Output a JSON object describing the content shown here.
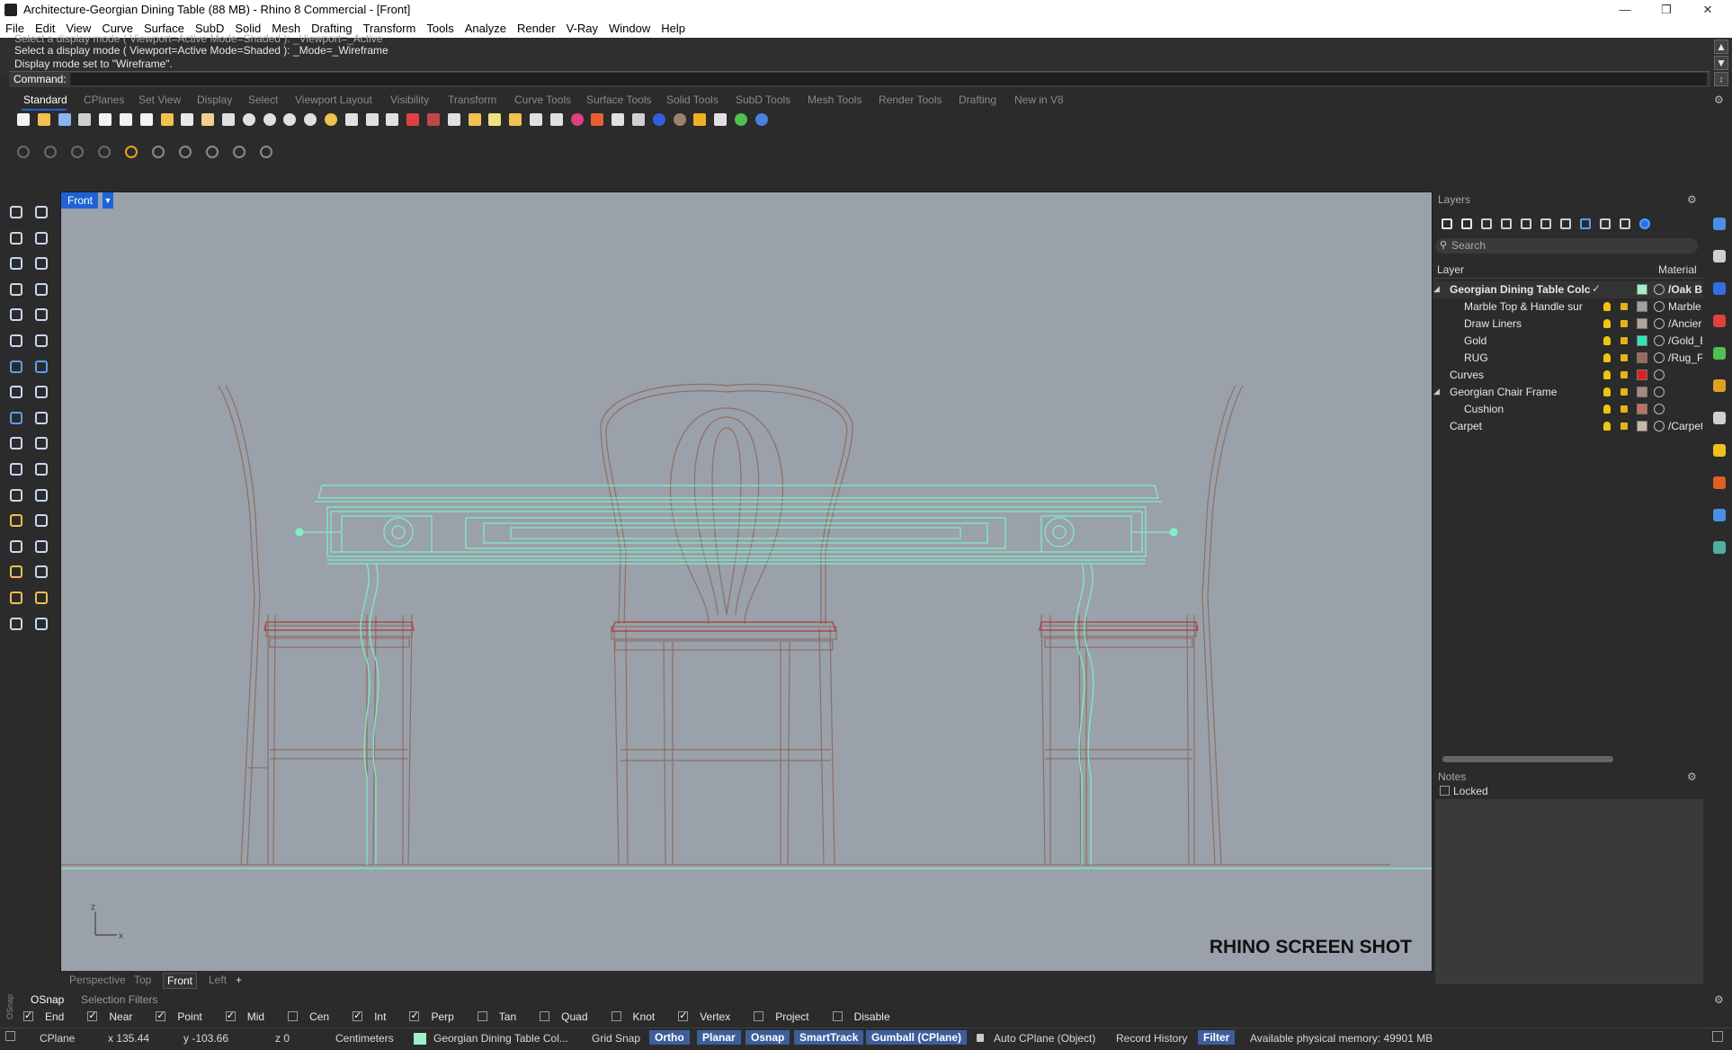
{
  "window": {
    "title": "Architecture-Georgian Dining Table (88 MB) - Rhino 8 Commercial - [Front]"
  },
  "menu": [
    "File",
    "Edit",
    "View",
    "Curve",
    "Surface",
    "SubD",
    "Solid",
    "Mesh",
    "Drafting",
    "Transform",
    "Tools",
    "Analyze",
    "Render",
    "V-Ray",
    "Window",
    "Help"
  ],
  "command_history": {
    "line0": "Select a display mode ( Viewport=Active  Mode=Shaded ): _Viewport=_Active",
    "line1": "Select a display mode ( Viewport=Active  Mode=Shaded ): _Mode=_Wireframe",
    "line2": "Display mode set to \"Wireframe\"."
  },
  "command_prompt": {
    "label": "Command:",
    "value": ""
  },
  "toolbar_tabs": [
    "Standard",
    "CPlanes",
    "Set View",
    "Display",
    "Select",
    "Viewport Layout",
    "Visibility",
    "Transform",
    "Curve Tools",
    "Surface Tools",
    "Solid Tools",
    "SubD Tools",
    "Mesh Tools",
    "Render Tools",
    "Drafting",
    "New in V8"
  ],
  "viewport": {
    "label": "Front",
    "watermark": "RHINO SCREEN SHOT",
    "axis_z": "z",
    "axis_x": "x"
  },
  "viewport_tabs": [
    "Perspective",
    "Top",
    "Front",
    "Left"
  ],
  "viewport_tab_add": "+",
  "layers_panel": {
    "title": "Layers",
    "search_placeholder": "Search",
    "col_layer": "Layer",
    "col_material": "Material",
    "rows": [
      {
        "name": "Georgian Dining Table Colc",
        "material": "/Oak B",
        "color": "#9ef0c8"
      },
      {
        "name": "Marble Top & Handle sur",
        "material": "Marble",
        "color": "#a0a0a0"
      },
      {
        "name": "Draw Liners",
        "material": "/Ancier",
        "color": "#b0a59a"
      },
      {
        "name": "Gold",
        "material": "/Gold_E",
        "color": "#2ee8b8"
      },
      {
        "name": "RUG",
        "material": "/Rug_P",
        "color": "#9c6b60"
      },
      {
        "name": "Curves",
        "material": "",
        "color": "#e02020"
      },
      {
        "name": "Georgian Chair Frame",
        "material": "",
        "color": "#a58a80"
      },
      {
        "name": "Cushion",
        "material": "",
        "color": "#c07060"
      },
      {
        "name": "Carpet",
        "material": "/Carpet",
        "color": "#c8b8a8"
      }
    ]
  },
  "notes_panel": {
    "title": "Notes",
    "locked_label": "Locked"
  },
  "osnap": {
    "tab_active": "OSnap",
    "tab_other": "Selection Filters",
    "side_label": "OSnap",
    "items": [
      {
        "label": "End",
        "checked": true
      },
      {
        "label": "Near",
        "checked": true
      },
      {
        "label": "Point",
        "checked": true
      },
      {
        "label": "Mid",
        "checked": true
      },
      {
        "label": "Cen",
        "checked": false
      },
      {
        "label": "Int",
        "checked": true
      },
      {
        "label": "Perp",
        "checked": true
      },
      {
        "label": "Tan",
        "checked": false
      },
      {
        "label": "Quad",
        "checked": false
      },
      {
        "label": "Knot",
        "checked": false
      },
      {
        "label": "Vertex",
        "checked": true
      },
      {
        "label": "Project",
        "checked": false
      },
      {
        "label": "Disable",
        "checked": false
      }
    ]
  },
  "status": {
    "cplane": "CPlane",
    "x": "x 135.44",
    "y": "y -103.66",
    "z": "z 0",
    "units": "Centimeters",
    "layer": "Georgian Dining Table Col...",
    "grid_snap": "Grid Snap",
    "ortho": "Ortho",
    "planar": "Planar",
    "osnap": "Osnap",
    "smarttrack": "SmartTrack",
    "gumball": "Gumball (CPlane)",
    "auto_cplane": "Auto CPlane (Object)",
    "record_history": "Record History",
    "filter": "Filter",
    "memory": "Available physical memory: 49901 MB"
  },
  "colors": {
    "viewport_bg": "#9aa1aa",
    "table_wire": "#7ff0c4",
    "chair_wire": "#8e6f66",
    "cushion_wire": "#b03a35",
    "active_blue": "#1e63d6"
  }
}
